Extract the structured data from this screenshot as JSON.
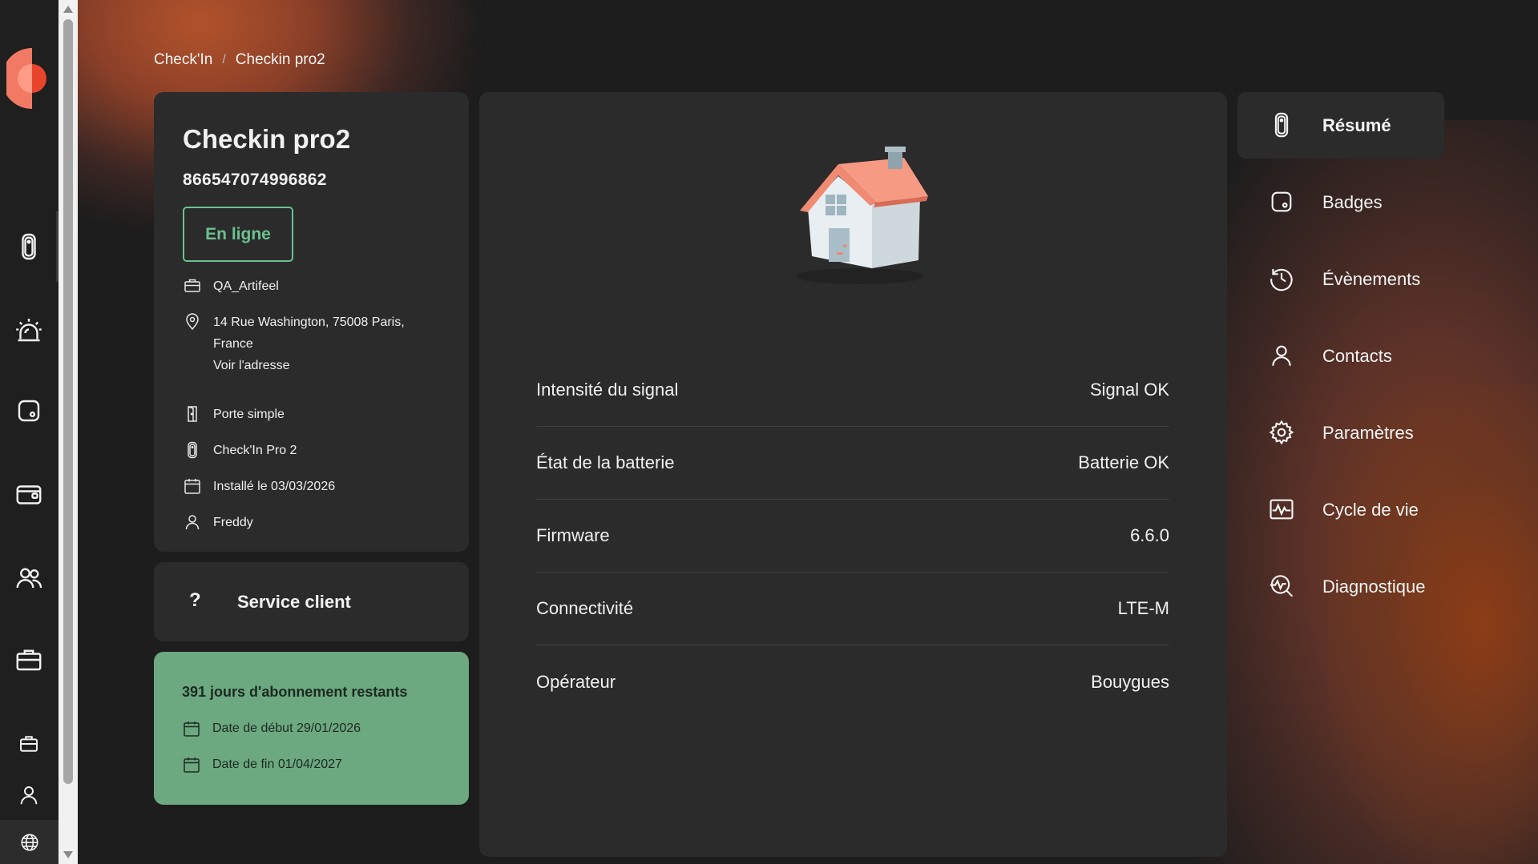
{
  "breadcrumb": {
    "root": "Check'In",
    "separator": "/",
    "current": "Checkin pro2"
  },
  "device": {
    "name": "Checkin pro2",
    "imei": "866547074996862",
    "status": "En ligne",
    "company": "QA_Artifeel",
    "address_line1": "14 Rue Washington, 75008 Paris,",
    "address_line2": "France",
    "address_link": "Voir l'adresse",
    "door_type": "Porte simple",
    "model": "Check'In Pro 2",
    "installed": "Installé le 03/03/2026",
    "installer": "Freddy"
  },
  "service": {
    "icon": "?",
    "label": "Service client"
  },
  "subscription": {
    "title": "391 jours d'abonnement restants",
    "start": "Date de début 29/01/2026",
    "end": "Date de fin 01/04/2027"
  },
  "specs": [
    {
      "label": "Intensité du signal",
      "value": "Signal OK"
    },
    {
      "label": "État de la batterie",
      "value": "Batterie OK"
    },
    {
      "label": "Firmware",
      "value": "6.6.0"
    },
    {
      "label": "Connectivité",
      "value": "LTE-M"
    },
    {
      "label": "Opérateur",
      "value": "Bouygues"
    }
  ],
  "nav": [
    {
      "label": "Résumé",
      "icon": "device-icon",
      "active": true
    },
    {
      "label": "Badges",
      "icon": "badge-icon",
      "active": false
    },
    {
      "label": "Évènements",
      "icon": "history-icon",
      "active": false
    },
    {
      "label": "Contacts",
      "icon": "user-icon",
      "active": false
    },
    {
      "label": "Paramètres",
      "icon": "gear-icon",
      "active": false
    },
    {
      "label": "Cycle de vie",
      "icon": "activity-icon",
      "active": false
    },
    {
      "label": "Diagnostique",
      "icon": "diagnostic-icon",
      "active": false
    }
  ],
  "rail_icons": [
    "device-icon",
    "alarm-icon",
    "badge-icon",
    "wallet-icon",
    "users-icon",
    "briefcase-icon",
    "briefcase-small-icon",
    "profile-icon",
    "globe-icon"
  ],
  "colors": {
    "accent": "#f27a64",
    "status_green": "#6cc18f",
    "subscription_bg": "#6ca880",
    "panel": "#2b2b2b"
  }
}
